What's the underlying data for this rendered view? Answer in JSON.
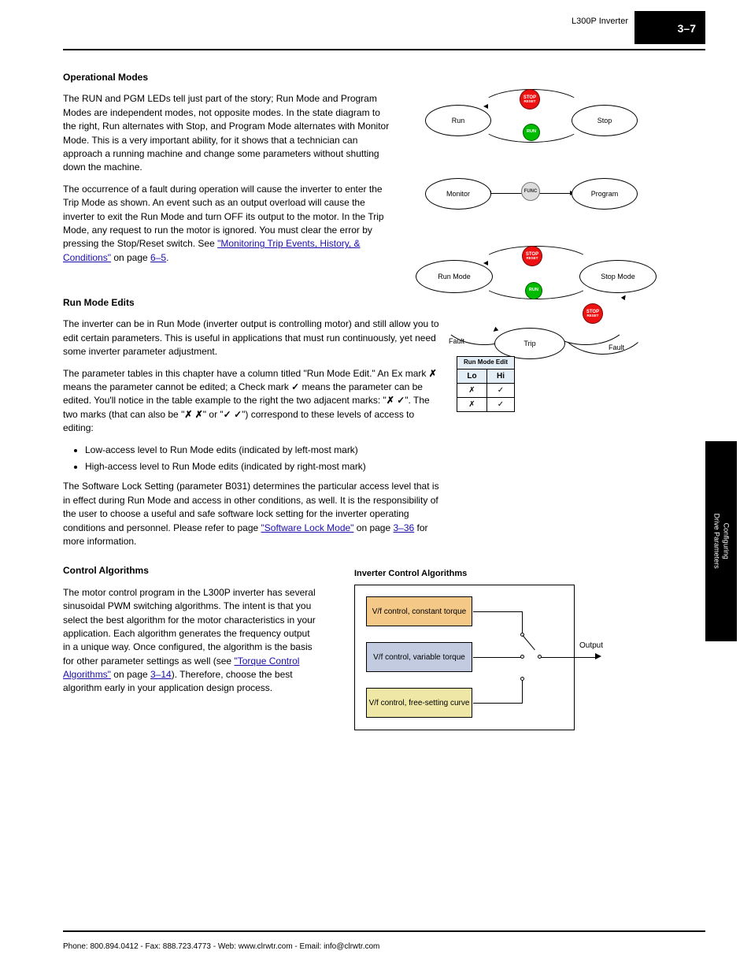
{
  "header": {
    "product": "L300P Inverter",
    "page_number": "3–7"
  },
  "sd1": {
    "left_state": "Run",
    "right_state": "Stop",
    "btn_stop": "STOP",
    "btn_reset": "RESET",
    "btn_run": "RUN"
  },
  "sd2": {
    "left_state": "Monitor",
    "right_state": "Program",
    "btn_func": "FUNC"
  },
  "sd3": {
    "left_state": "Run Mode",
    "right_state": "Stop Mode",
    "bottom_state": "Trip",
    "btn_stop": "STOP",
    "btn_reset": "RESET",
    "btn_run": "RUN",
    "bottom_label": "Fault"
  },
  "s1": {
    "title": "Operational Modes",
    "p1": "The RUN and PGM LEDs tell just part of the story; Run Mode and Program Modes are independent modes, not opposite modes. In the state diagram to the right, Run alternates with Stop, and Program Mode alternates with Monitor Mode. This is a very important ability, for it shows that a technician can approach a running machine and change some parameters without shutting down the machine.",
    "p2_pre": "The occurrence of a fault during operation will cause the inverter to enter the Trip Mode as shown. An event such as an output overload will cause the inverter to exit the Run Mode and turn OFF its output to the motor. In the Trip Mode, any request to run the motor is ignored. You must clear the error by pressing the Stop/Reset switch. See ",
    "link1": "\"Monitoring Trip Events, History, & Conditions\"",
    "p2_mid": " on page ",
    "link2": "6–5",
    "p2_post": "."
  },
  "s2": {
    "title": "Run Mode Edits",
    "p1_pre": "The inverter can be in Run Mode (inverter output is controlling motor) and still allow you to edit certain parameters. This is useful in applications that must run continuously, yet need some inverter parameter adjustment.",
    "p2_pre": "The parameter tables in this chapter have a column titled \"Run Mode Edit.\" An Ex mark ",
    "check": "✓",
    "p2_mid": " means the parameter cannot be edited; a Check mark ",
    "p2_mid2": " means the parameter can be edited. You'll notice in the table example to the right the two adjacent marks: \"",
    "x": "✗",
    "p2_mid3": " ",
    "p2_mid4": "\". The two marks (that can also be \"",
    "p2_mid5": "\" or \"",
    "p2_after_lo_hi": "\") correspond to these levels of access to editing:",
    "bullet1": "Low-access level to Run Mode edits (indicated by left-most mark)",
    "bullet2": "High-access level to Run Mode edits (indicated by right-most mark)",
    "p3_pre": "The Software Lock Setting (parameter B031) determines the particular access level that is in effect during Run Mode and access in other conditions, as well. It is the responsibility of the user to choose a useful and safe software lock setting for the inverter operating conditions and personnel. Please refer to page ",
    "link": "\"Software Lock Mode\"",
    "p3_mid": " on page ",
    "link2": "3–36",
    "p3_post": " for more information."
  },
  "table": {
    "header_top": "Run Mode Edit",
    "header_lo": "Lo",
    "header_hi": "Hi",
    "r1_lo": "✗",
    "r1_hi": "✓",
    "r2_lo": "✗",
    "r2_hi": "✓"
  },
  "s3": {
    "title": "Control Algorithms",
    "p_pre": "The motor control program in the L300P inverter has several sinusoidal PWM switching algorithms. The intent is that you select the best algorithm for the motor characteristics in your application. Each algorithm generates the frequency output in a unique way. Once configured, the algorithm is the basis for other parameter settings as well (see ",
    "link": "\"Torque Control Algorithms\"",
    "p_mid": " on page ",
    "link2": "3–14",
    "p_post": "). Therefore, choose the best algorithm early in your application design process.",
    "blk_title": "Inverter Control Algorithms",
    "src_a": "V/f control, constant torque",
    "src_b": "V/f control, variable torque",
    "src_c": "V/f control, free-setting curve",
    "out_label": "Output"
  },
  "side_tab": {
    "line1": "Configuring",
    "line2": "Drive Parameters"
  },
  "footer": {
    "left": "Phone: 800.894.0412  -  Fax: 888.723.4773  -  Web: www.clrwtr.com  -  Email: info@clrwtr.com"
  }
}
